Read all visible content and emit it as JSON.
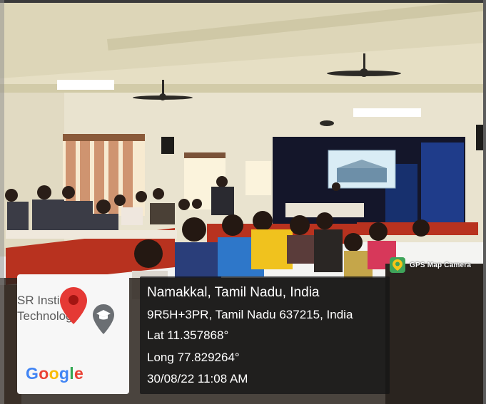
{
  "photo": {
    "banner_icon": "building-illustration-banner"
  },
  "gps_badge": {
    "label": "GPS Map Camera",
    "icon": "map-pin-icon",
    "color": "#3fa45a"
  },
  "map": {
    "place_text": "SR Insti\nTechnology",
    "pin_icon": "map-pin-icon",
    "pin_color": "#e53935",
    "place_icon": "graduation-cap-icon",
    "logo": "Google",
    "logo_colors": [
      "#4285F4",
      "#EA4335",
      "#FBBC05",
      "#4285F4",
      "#34A853",
      "#EA4335"
    ]
  },
  "info": {
    "location": "Namakkal, Tamil Nadu, India",
    "address": "9R5H+3PR, Tamil Nadu 637215, India",
    "lat": "Lat 11.357868°",
    "long": "Long 77.829264°",
    "datetime": "30/08/22 11:08 AM"
  }
}
